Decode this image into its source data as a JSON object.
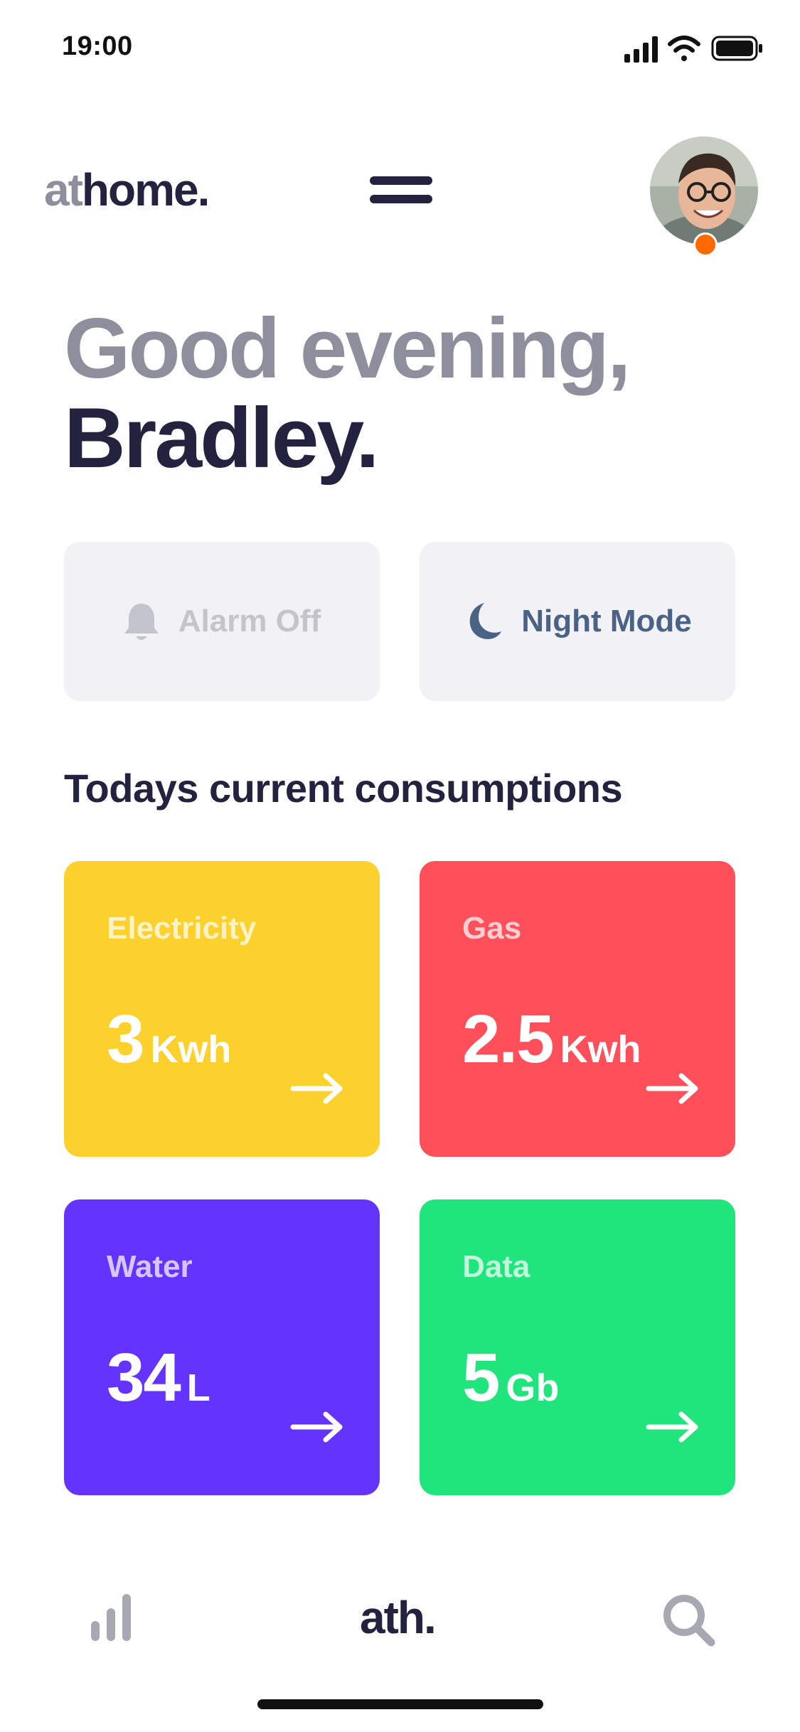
{
  "status_bar": {
    "time": "19:00"
  },
  "header": {
    "logo_prefix": "at",
    "logo_suffix": "home.",
    "menu_icon": "hamburger-menu-icon",
    "avatar": "user-avatar-photo"
  },
  "greeting": {
    "line1": "Good evening,",
    "line2": "Bradley."
  },
  "toggles": [
    {
      "label": "Alarm Off",
      "icon": "bell-icon",
      "state": "off"
    },
    {
      "label": "Night Mode",
      "icon": "moon-icon",
      "state": "on"
    }
  ],
  "section_title": "Todays current consumptions",
  "cards": [
    {
      "label": "Electricity",
      "value": "3",
      "unit": "Kwh",
      "color": "#fdd12d"
    },
    {
      "label": "Gas",
      "value": "2.5",
      "unit": "Kwh",
      "color": "#fe4f5b"
    },
    {
      "label": "Water",
      "value": "34",
      "unit": "L",
      "color": "#6533fe"
    },
    {
      "label": "Data",
      "value": "5",
      "unit": "Gb",
      "color": "#20e57d"
    }
  ],
  "bottom_nav": {
    "left_icon": "bar-chart-icon",
    "center_label": "ath.",
    "right_icon": "search-icon"
  },
  "colors": {
    "accent_dark": "#23233f",
    "muted": "#8e8e9c",
    "notification_dot": "#ff6a00"
  }
}
